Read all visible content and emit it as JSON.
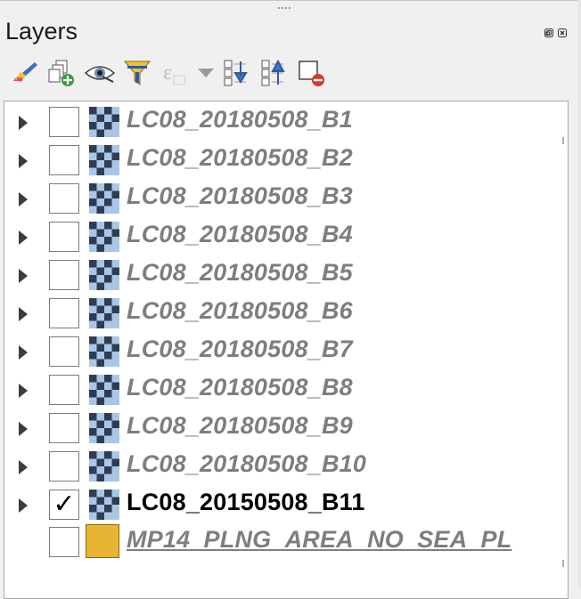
{
  "panel": {
    "title": "Layers"
  },
  "title_buttons": [
    {
      "icon": "float-icon"
    },
    {
      "icon": "close-icon"
    }
  ],
  "toolbar": [
    {
      "icon": "style-brush-icon"
    },
    {
      "icon": "add-group-icon"
    },
    {
      "icon": "visibility-eye-icon"
    },
    {
      "icon": "filter-legend-icon"
    },
    {
      "icon": "filter-expression-icon"
    },
    {
      "icon": "expand-all-icon"
    },
    {
      "icon": "collapse-all-icon"
    },
    {
      "icon": "remove-layer-icon"
    }
  ],
  "layers": [
    {
      "name": "LC08_20180508_B1",
      "checked": "",
      "kind": "raster"
    },
    {
      "name": "LC08_20180508_B2",
      "checked": "",
      "kind": "raster"
    },
    {
      "name": "LC08_20180508_B3",
      "checked": "",
      "kind": "raster"
    },
    {
      "name": "LC08_20180508_B4",
      "checked": "",
      "kind": "raster"
    },
    {
      "name": "LC08_20180508_B5",
      "checked": "",
      "kind": "raster"
    },
    {
      "name": "LC08_20180508_B6",
      "checked": "",
      "kind": "raster"
    },
    {
      "name": "LC08_20180508_B7",
      "checked": "",
      "kind": "raster"
    },
    {
      "name": "LC08_20180508_B8",
      "checked": "",
      "kind": "raster"
    },
    {
      "name": "LC08_20180508_B9",
      "checked": "",
      "kind": "raster"
    },
    {
      "name": "LC08_20180508_B10",
      "checked": "",
      "kind": "raster"
    },
    {
      "name": "LC08_20150508_B11",
      "checked": "✓",
      "kind": "raster"
    },
    {
      "name": "MP14_PLNG_AREA_NO_SEA_PL",
      "checked": "",
      "kind": "vector"
    }
  ],
  "colors": {
    "vector_fill": "#e8b434",
    "inactive_text": "#7e7e7e",
    "active_text": "#000000",
    "raster_dark": "#2e3d52",
    "raster_light": "#a9c6e6"
  }
}
